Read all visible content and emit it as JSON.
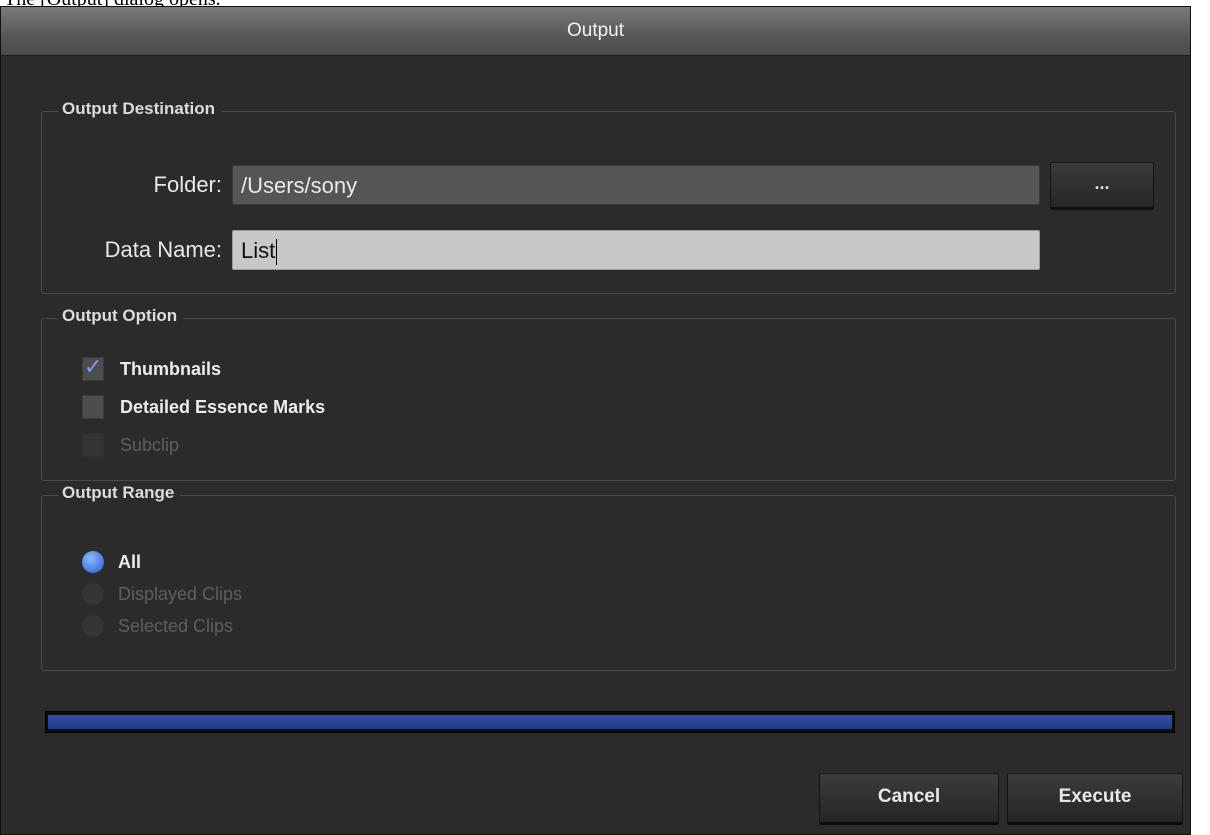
{
  "caption": "The [Output] dialog opens.",
  "dialog": {
    "title": "Output",
    "output_destination": {
      "group_title": "Output Destination",
      "folder_label": "Folder:",
      "folder_value": "/Users/sony",
      "browse_label": "...",
      "data_name_label": "Data Name:",
      "data_name_value": "List"
    },
    "output_option": {
      "group_title": "Output Option",
      "options": [
        {
          "label": "Thumbnails",
          "checked": true,
          "enabled": true
        },
        {
          "label": "Detailed Essence Marks",
          "checked": false,
          "enabled": true
        },
        {
          "label": "Subclip",
          "checked": false,
          "enabled": false
        }
      ]
    },
    "output_range": {
      "group_title": "Output Range",
      "options": [
        {
          "label": "All",
          "selected": true,
          "enabled": true
        },
        {
          "label": "Displayed Clips",
          "selected": false,
          "enabled": false
        },
        {
          "label": "Selected Clips",
          "selected": false,
          "enabled": false
        }
      ]
    },
    "progress": 1.0,
    "cancel_label": "Cancel",
    "execute_label": "Execute",
    "accent_color": "#3d76e0"
  }
}
